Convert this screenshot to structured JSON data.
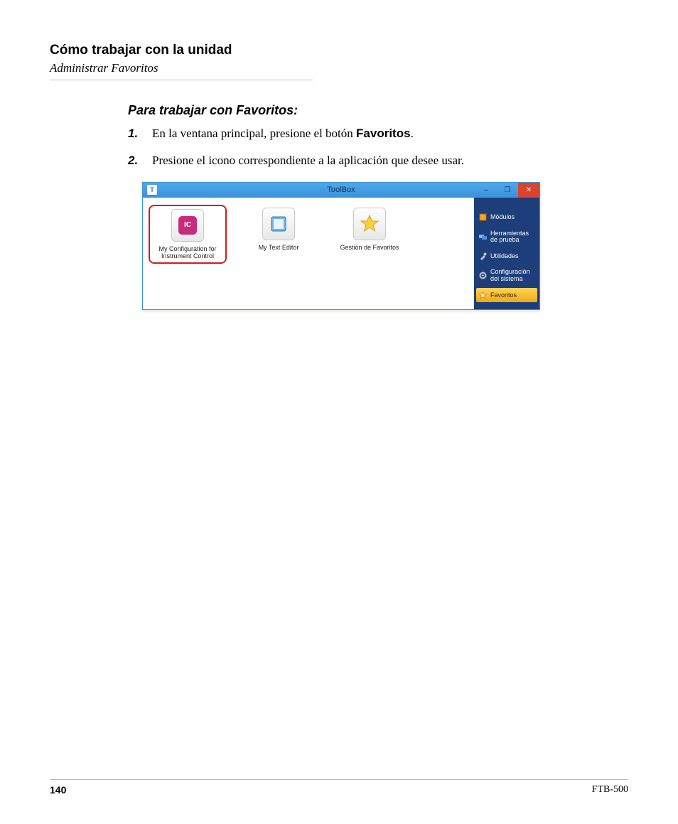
{
  "header": {
    "title": "Cómo trabajar con la unidad",
    "subtitle": "Administrar Favoritos"
  },
  "section": {
    "title": "Para trabajar con Favoritos:",
    "steps": [
      {
        "num": "1.",
        "pre": "En la ventana principal, presione el botón ",
        "bold": "Favoritos",
        "post": "."
      },
      {
        "num": "2.",
        "pre": "Presione el icono correspondiente a la aplicación que desee usar.",
        "bold": "",
        "post": ""
      }
    ]
  },
  "window": {
    "title": "ToolBox",
    "icon_letter": "T",
    "controls": {
      "min": "–",
      "max": "❐",
      "close": "✕"
    },
    "tiles": [
      {
        "label": "My Configuration for Instrument Control",
        "badge": "IC",
        "selected": true
      },
      {
        "label": "My Text Editor",
        "badge": "",
        "selected": false
      },
      {
        "label": "Gestión de Favoritos",
        "badge": "",
        "selected": false
      }
    ],
    "sidebar": [
      {
        "label": "Módulos",
        "active": false
      },
      {
        "label": "Herramientas de prueba",
        "active": false
      },
      {
        "label": "Utilidades",
        "active": false
      },
      {
        "label": "Configuración del sistema",
        "active": false
      },
      {
        "label": "Favoritos",
        "active": true
      }
    ]
  },
  "footer": {
    "page": "140",
    "doc": "FTB-500"
  }
}
